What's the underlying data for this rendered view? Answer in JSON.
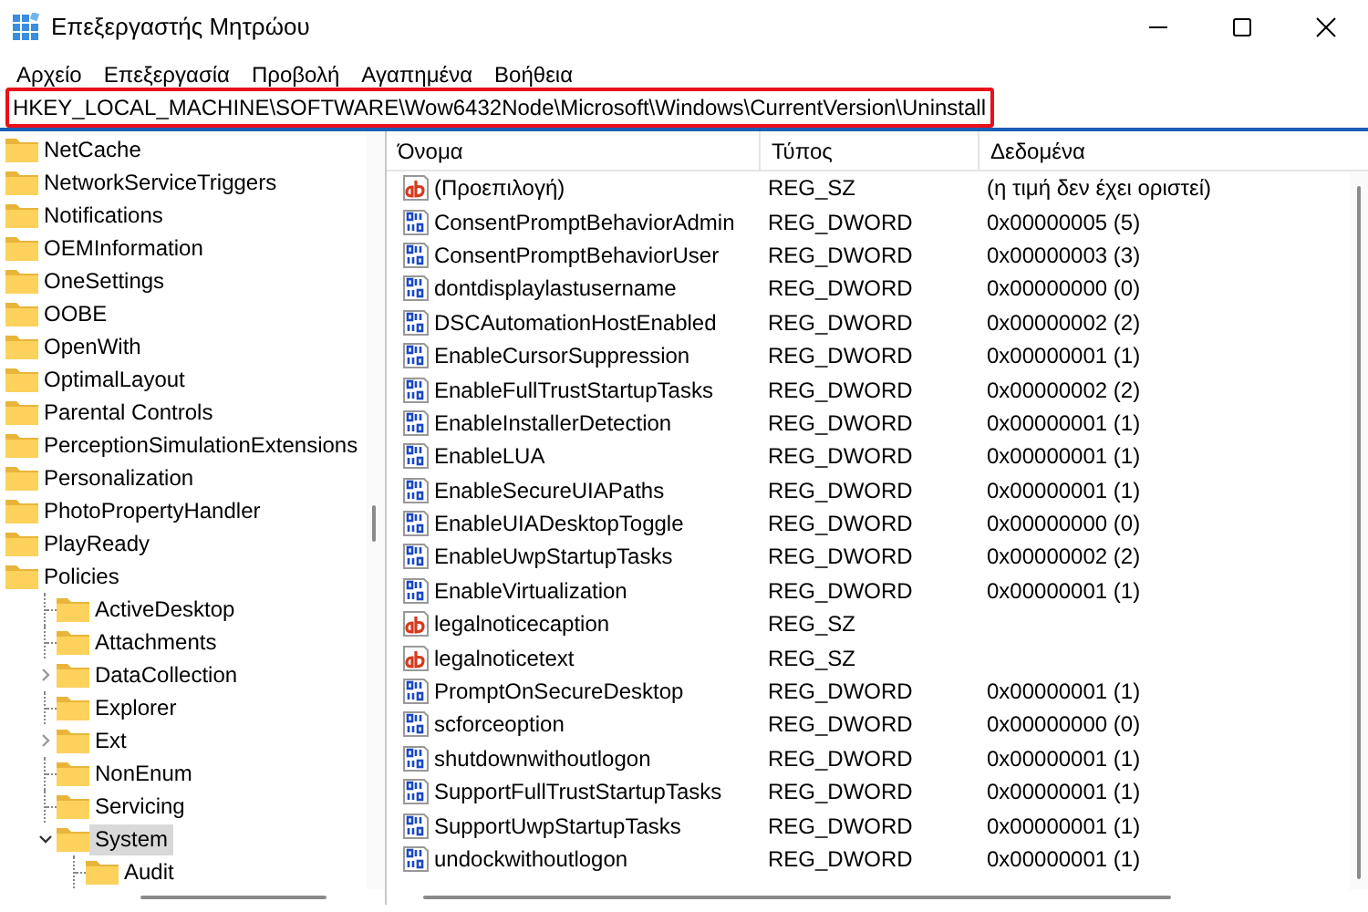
{
  "window": {
    "title": "Επεξεργαστής Μητρώου"
  },
  "menu": [
    "Αρχείο",
    "Επεξεργασία",
    "Προβολή",
    "Αγαπημένα",
    "Βοήθεια"
  ],
  "address": {
    "value": "HKEY_LOCAL_MACHINE\\SOFTWARE\\Wow6432Node\\Microsoft\\Windows\\CurrentVersion\\Uninstall",
    "highlighted": true
  },
  "tree": [
    {
      "label": "NetCache",
      "selected": false
    },
    {
      "label": "NetworkServiceTriggers",
      "selected": false
    },
    {
      "label": "Notifications",
      "selected": false
    },
    {
      "label": "OEMInformation",
      "selected": false
    },
    {
      "label": "OneSettings",
      "selected": false
    },
    {
      "label": "OOBE",
      "selected": false
    },
    {
      "label": "OpenWith",
      "selected": false
    },
    {
      "label": "OptimalLayout",
      "selected": false
    },
    {
      "label": "Parental Controls",
      "selected": false
    },
    {
      "label": "PerceptionSimulationExtensions",
      "selected": false
    },
    {
      "label": "Personalization",
      "selected": false
    },
    {
      "label": "PhotoPropertyHandler",
      "selected": false
    },
    {
      "label": "PlayReady",
      "selected": false
    },
    {
      "label": "Policies",
      "selected": false,
      "children": [
        {
          "label": "ActiveDesktop",
          "selected": false,
          "kind": "leaf"
        },
        {
          "label": "Attachments",
          "selected": false,
          "kind": "leaf"
        },
        {
          "label": "DataCollection",
          "selected": false,
          "kind": "collapsed"
        },
        {
          "label": "Explorer",
          "selected": false,
          "kind": "leaf"
        },
        {
          "label": "Ext",
          "selected": false,
          "kind": "collapsed"
        },
        {
          "label": "NonEnum",
          "selected": false,
          "kind": "leaf"
        },
        {
          "label": "Servicing",
          "selected": false,
          "kind": "leaf"
        },
        {
          "label": "System",
          "selected": true,
          "kind": "expanded",
          "children": [
            {
              "label": "Audit",
              "selected": false,
              "kind": "leaf"
            }
          ]
        }
      ]
    }
  ],
  "table": {
    "columns": [
      "Όνομα",
      "Τύπος",
      "Δεδομένα"
    ],
    "rows": [
      {
        "kind": "string",
        "name": "(Προεπιλογή)",
        "type": "REG_SZ",
        "data": "(η τιμή δεν έχει οριστεί)"
      },
      {
        "kind": "binary",
        "name": "ConsentPromptBehaviorAdmin",
        "type": "REG_DWORD",
        "data": "0x00000005 (5)"
      },
      {
        "kind": "binary",
        "name": "ConsentPromptBehaviorUser",
        "type": "REG_DWORD",
        "data": "0x00000003 (3)"
      },
      {
        "kind": "binary",
        "name": "dontdisplaylastusername",
        "type": "REG_DWORD",
        "data": "0x00000000 (0)"
      },
      {
        "kind": "binary",
        "name": "DSCAutomationHostEnabled",
        "type": "REG_DWORD",
        "data": "0x00000002 (2)"
      },
      {
        "kind": "binary",
        "name": "EnableCursorSuppression",
        "type": "REG_DWORD",
        "data": "0x00000001 (1)"
      },
      {
        "kind": "binary",
        "name": "EnableFullTrustStartupTasks",
        "type": "REG_DWORD",
        "data": "0x00000002 (2)"
      },
      {
        "kind": "binary",
        "name": "EnableInstallerDetection",
        "type": "REG_DWORD",
        "data": "0x00000001 (1)"
      },
      {
        "kind": "binary",
        "name": "EnableLUA",
        "type": "REG_DWORD",
        "data": "0x00000001 (1)"
      },
      {
        "kind": "binary",
        "name": "EnableSecureUIAPaths",
        "type": "REG_DWORD",
        "data": "0x00000001 (1)"
      },
      {
        "kind": "binary",
        "name": "EnableUIADesktopToggle",
        "type": "REG_DWORD",
        "data": "0x00000000 (0)"
      },
      {
        "kind": "binary",
        "name": "EnableUwpStartupTasks",
        "type": "REG_DWORD",
        "data": "0x00000002 (2)"
      },
      {
        "kind": "binary",
        "name": "EnableVirtualization",
        "type": "REG_DWORD",
        "data": "0x00000001 (1)"
      },
      {
        "kind": "string",
        "name": "legalnoticecaption",
        "type": "REG_SZ"
      },
      {
        "kind": "string",
        "name": "legalnoticetext",
        "type": "REG_SZ"
      },
      {
        "kind": "binary",
        "name": "PromptOnSecureDesktop",
        "type": "REG_DWORD",
        "data": "0x00000001 (1)"
      },
      {
        "kind": "binary",
        "name": "scforceoption",
        "type": "REG_DWORD",
        "data": "0x00000000 (0)"
      },
      {
        "kind": "binary",
        "name": "shutdownwithoutlogon",
        "type": "REG_DWORD",
        "data": "0x00000001 (1)"
      },
      {
        "kind": "binary",
        "name": "SupportFullTrustStartupTasks",
        "type": "REG_DWORD",
        "data": "0x00000001 (1)"
      },
      {
        "kind": "binary",
        "name": "SupportUwpStartupTasks",
        "type": "REG_DWORD",
        "data": "0x00000001 (1)"
      },
      {
        "kind": "binary",
        "name": "undockwithoutlogon",
        "type": "REG_DWORD",
        "data": "0x00000001 (1)"
      }
    ]
  }
}
